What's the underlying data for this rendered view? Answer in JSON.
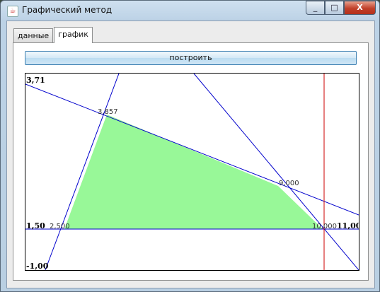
{
  "window": {
    "title": "Графический метод",
    "icon": "java-icon",
    "minimize_glyph": "_",
    "maximize_glyph": "□",
    "close_glyph": "X"
  },
  "tabs": [
    {
      "label": "данные",
      "active": false
    },
    {
      "label": "график",
      "active": true
    }
  ],
  "toolbar": {
    "build_label": "построить"
  },
  "colors": {
    "fill": "#98f898",
    "lines": "#0000cc",
    "marker": "#cc0000"
  },
  "plot": {
    "y_labels": {
      "top": "3,71",
      "mid": "1,50",
      "bottom": "-1,00"
    },
    "x_labels": {
      "right": "11,00"
    },
    "vertex_labels": [
      "2,500",
      "3,857",
      "9,000",
      "10,000"
    ]
  },
  "chart_data": {
    "type": "scatter",
    "ylim": [
      -1.0,
      3.71
    ],
    "feasible_region": [
      [
        2.5,
        1.5
      ],
      [
        3.857,
        3.2
      ],
      [
        9.0,
        2.2
      ],
      [
        10.0,
        1.5
      ]
    ],
    "vertex_labels": [
      "2,500",
      "3,857",
      "9,000",
      "10,000"
    ],
    "marker_line_x": 10.0,
    "y_tick_labels": [
      "3,71",
      "1,50",
      "-1,00"
    ],
    "x_tick_labels": [
      "11,00"
    ]
  }
}
